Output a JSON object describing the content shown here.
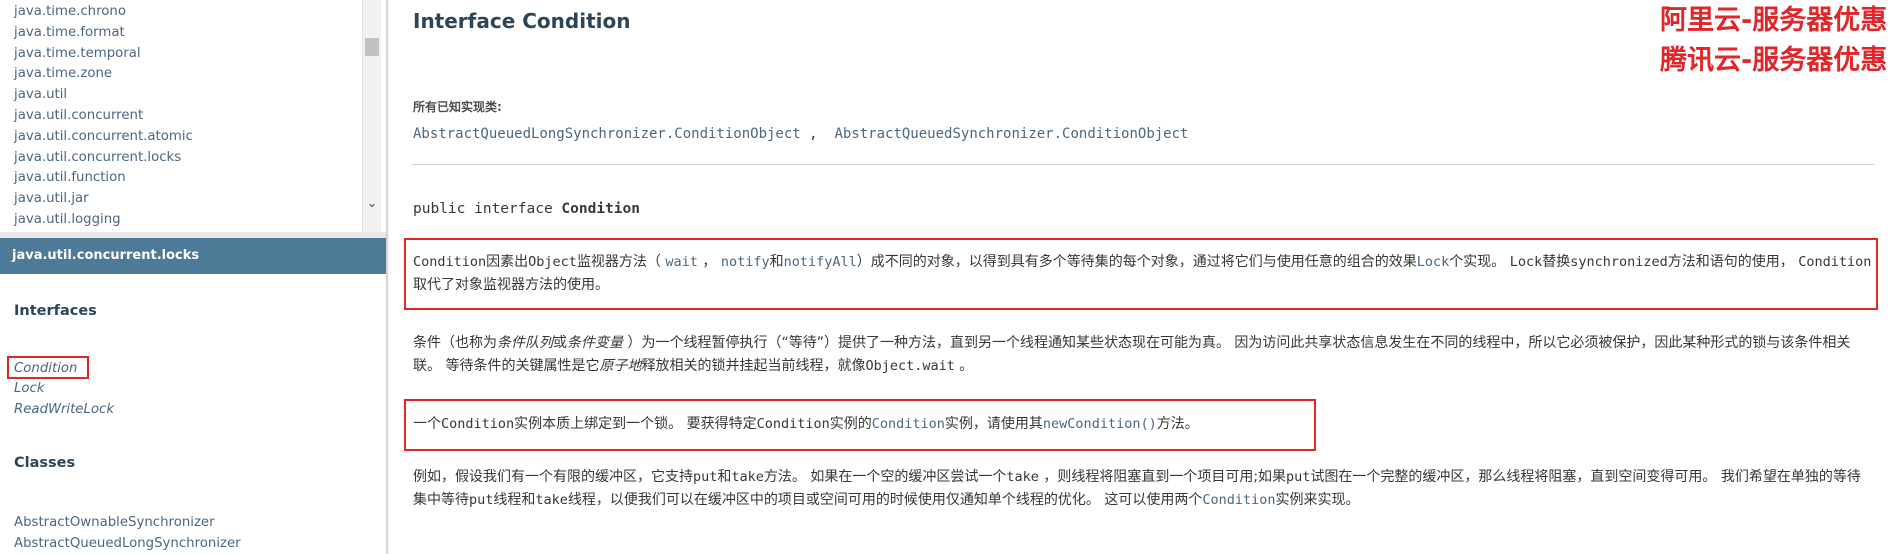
{
  "package_list": [
    "java.time.chrono",
    "java.time.format",
    "java.time.temporal",
    "java.time.zone",
    "java.util",
    "java.util.concurrent",
    "java.util.concurrent.atomic",
    "java.util.concurrent.locks",
    "java.util.function",
    "java.util.jar",
    "java.util.logging"
  ],
  "class_frame": {
    "package_title": "java.util.concurrent.locks",
    "interfaces_heading": "Interfaces",
    "interfaces": [
      "Condition",
      "Lock",
      "ReadWriteLock"
    ],
    "classes_heading": "Classes",
    "classes": [
      "AbstractOwnableSynchronizer",
      "AbstractQueuedLongSynchronizer"
    ]
  },
  "content": {
    "title": "Interface Condition",
    "implementing_label": "所有已知实现类:",
    "implementing_classes": [
      "AbstractQueuedLongSynchronizer.ConditionObject",
      "AbstractQueuedSynchronizer.ConditionObject"
    ],
    "impl_separator": " ,",
    "signature_prefix": "public interface ",
    "signature_name": "Condition",
    "para1": {
      "a": "Condition",
      "b": "因素出",
      "c": "Object",
      "d": "监视器方法（ ",
      "e": "wait",
      "f": " ， ",
      "g": "notify",
      "h": "和",
      "i": "notifyAll",
      "j": "）成不同的对象，以得到具有多个等待集的每个对象，通过将它们与使用任意的组合的效果",
      "k": "Lock",
      "l": "个实现。 ",
      "m": "Lock",
      "n": "替换",
      "o": "synchronized",
      "p": "方法和语句的使用， ",
      "q": "Condition",
      "r": "取代了对象监视器方法的使用。"
    },
    "para2": {
      "a": "条件（也称为",
      "b": "条件队列",
      "c": "或",
      "d": "条件变量",
      "e": " ）为一个线程暂停执行（“等待”）提供了一种方法，直到另一个线程通知某些状态现在可能为真。 因为访问此共享状态信息发生在不同的线程中，所以它必须被保护，因此某种形式的锁与该条件相关联。 等待条件的关键属性是它",
      "f": "原子地",
      "g": "释放相关的锁并挂起当前线程，就像",
      "h": "Object.wait",
      "i": " 。"
    },
    "para3": {
      "a": "一个",
      "b": "Condition",
      "c": "实例本质上绑定到一个锁。 要获得特定",
      "d": "Condition",
      "e": "实例的",
      "f": "Condition",
      "g": "实例，请使用其",
      "h": "newCondition()",
      "i": "方法。"
    },
    "para4": {
      "a": "例如，假设我们有一个有限的缓冲区，它支持",
      "b": "put",
      "c": "和",
      "d": "take",
      "e": "方法。 如果在一个空的缓冲区尝试一个",
      "f": "take",
      "g": " ，则线程将阻塞直到一个项目可用;如果",
      "h": "put",
      "i": "试图在一个完整的缓冲区，那么线程将阻塞，直到空间变得可用。 我们希望在单独的等待集中等待",
      "j": "put",
      "k": "线程和",
      "l": "take",
      "m": "线程，以便我们可以在缓冲区中的项目或空间可用的时候使用仅通知单个线程的优化。 这可以使用两个",
      "n": "Condition",
      "o": "实例来实现。"
    }
  },
  "ads": [
    "阿里云-服务器优惠",
    "腾讯云-服务器优惠"
  ],
  "colors": {
    "accent_red": "#e0262a",
    "header_blue": "#4d7a97",
    "link": "#4a6782"
  }
}
